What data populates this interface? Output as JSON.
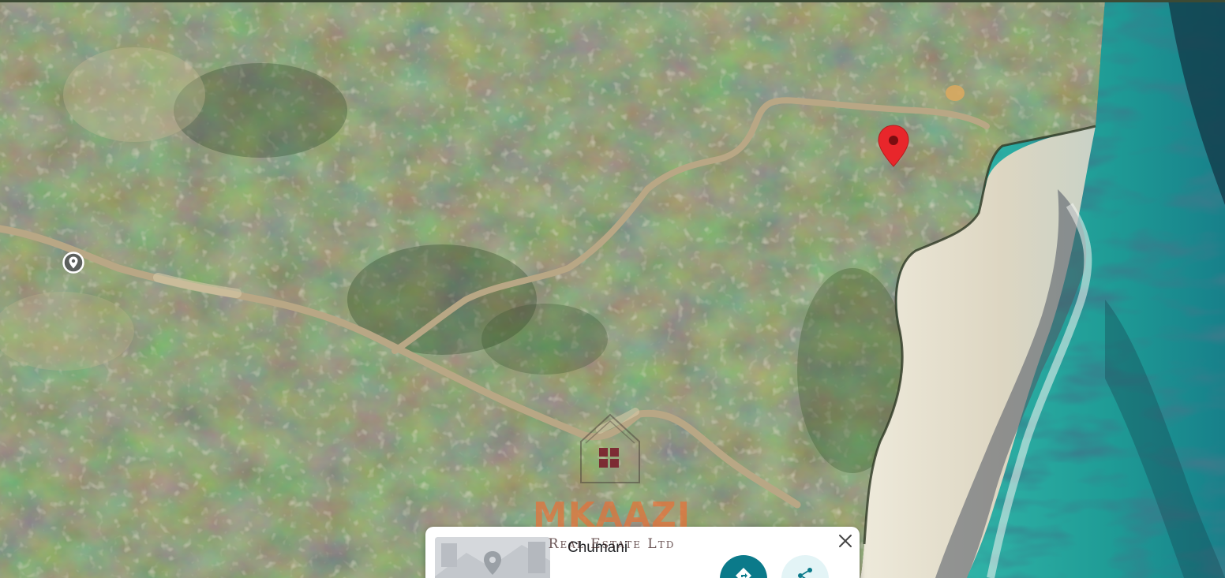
{
  "map": {
    "view": "satellite",
    "colors": {
      "vegetation": "#4d5a35",
      "dense_vegetation": "#34482a",
      "dirt_track": "#b4a27e",
      "sand": "#e6e0cc",
      "ocean": "#2fb3a6",
      "deep_water": "#163c48",
      "selected_pin": "#e8262b"
    },
    "markers": [
      {
        "type": "selected-location-pin",
        "icon": "map-pin-icon"
      },
      {
        "type": "place-marker",
        "icon": "location-marker-icon"
      }
    ]
  },
  "watermark": {
    "brand": "MKAAZI",
    "subtitle": "Real Estate Ltd",
    "icon": "house-logo-icon"
  },
  "info_card": {
    "title": "Chumani",
    "thumbnail_icon": "map-thumbnail-icon",
    "close_icon": "close-icon",
    "directions_icon": "directions-icon",
    "share_icon": "share-icon",
    "accent_color": "#0b7a8a"
  }
}
